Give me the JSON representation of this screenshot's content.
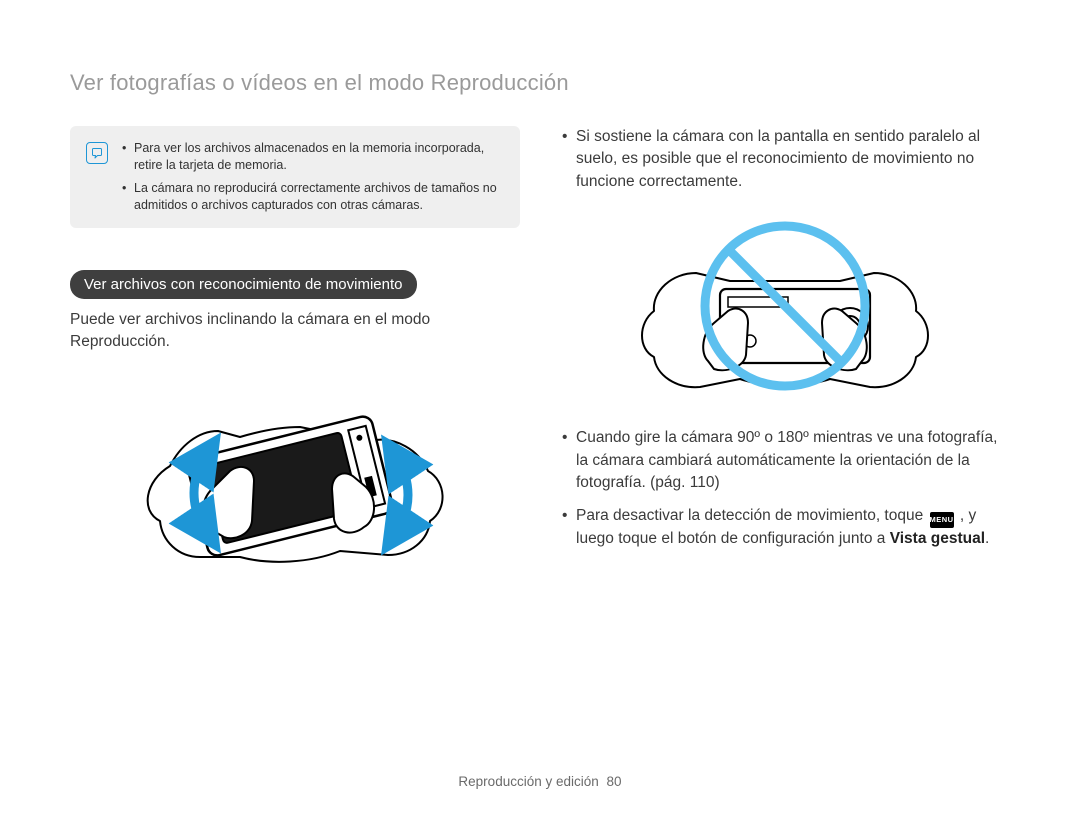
{
  "pageTitle": "Ver fotografías o vídeos en el modo Reproducción",
  "noteBox": {
    "items": [
      "Para ver los archivos almacenados en la memoria incorporada, retire la tarjeta de memoria.",
      "La cámara no reproducirá correctamente archivos de tamaños no admitidos o archivos capturados con otras cámaras."
    ]
  },
  "section": {
    "heading": "Ver archivos con reconocimiento de movimiento",
    "intro": "Puede ver archivos inclinando la cámara en el modo Reproducción."
  },
  "rightTop": "Si sostiene la cámara con la pantalla en sentido paralelo al suelo, es posible que el reconocimiento de movimiento no funcione correctamente.",
  "rightBullets": {
    "b1": "Cuando gire la cámara 90º o 180º mientras ve una fotografía, la cámara cambiará automáticamente la orientación de la fotografía. (pág. 110)",
    "b2_pre": "Para desactivar la detección de movimiento, toque ",
    "b2_menu": "MENU",
    "b2_mid": " , y luego toque el botón de configuración junto a ",
    "b2_bold": "Vista gestual",
    "b2_post": "."
  },
  "footer": {
    "section": "Reproducción y edición",
    "page": "80"
  }
}
